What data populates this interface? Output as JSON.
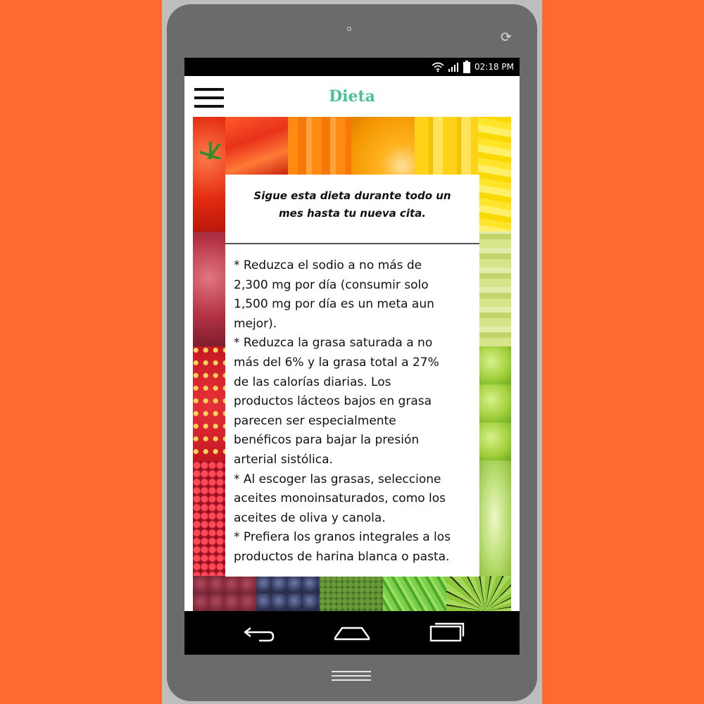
{
  "status_bar": {
    "time": "02:18 PM",
    "icons": [
      "wifi-icon",
      "signal-icon",
      "battery-icon"
    ]
  },
  "app_bar": {
    "title": "Dieta",
    "menu_icon": "hamburger-menu-icon"
  },
  "card": {
    "heading": "Sigue esta dieta durante todo un\nmes hasta tu nueva cita.",
    "body": "* Reduzca el sodio a no más de\n2,300 mg por día (consumir solo\n1,500 mg por día es un meta aun\nmejor).\n* Reduzca la grasa saturada a no\nmás del 6% y la grasa total a 27%\nde las calorías diarias. Los\nproductos lácteos bajos en grasa\nparecen ser especialmente\nbenéficos para bajar la presión\narterial sistólica.\n* Al escoger las grasas, seleccione\naceites monoinsaturados, como los\naceites de oliva y canola.\n* Prefiera los granos integrales a los\nproductos de harina blanca o pasta."
  },
  "nav_bar": {
    "buttons": [
      "back-icon",
      "home-icon",
      "recent-apps-icon"
    ]
  },
  "colors": {
    "accent": "#4cc09a",
    "background": "#ff6a2e",
    "phone_body": "#6b6b6b"
  }
}
